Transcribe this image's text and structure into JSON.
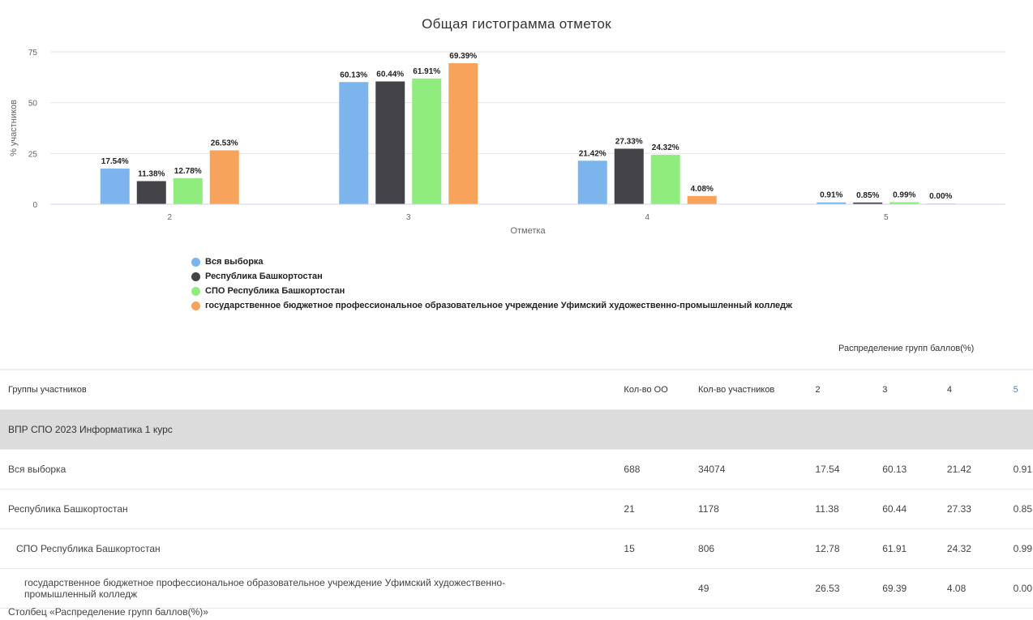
{
  "chart_data": {
    "type": "bar",
    "title": "Общая гистограмма отметок",
    "xlabel": "Отметка",
    "ylabel": "% участников",
    "categories": [
      "2",
      "3",
      "4",
      "5"
    ],
    "y_ticks": [
      "0",
      "25",
      "50",
      "75"
    ],
    "ylim": [
      0,
      75
    ],
    "grid": true,
    "legend_position": "bottom-left",
    "series": [
      {
        "name": "Вся выборка",
        "color": "#7cb5ec",
        "values": [
          17.54,
          60.13,
          21.42,
          0.91
        ],
        "labels": [
          "17.54%",
          "60.13%",
          "21.42%",
          "0.91%"
        ]
      },
      {
        "name": "Республика Башкортостан",
        "color": "#434348",
        "values": [
          11.38,
          60.44,
          27.33,
          0.85
        ],
        "labels": [
          "11.38%",
          "60.44%",
          "27.33%",
          "0.85%"
        ]
      },
      {
        "name": "СПО Республика Башкортостан",
        "color": "#90ed7d",
        "values": [
          12.78,
          61.91,
          24.32,
          0.99
        ],
        "labels": [
          "12.78%",
          "61.91%",
          "24.32%",
          "0.99%"
        ]
      },
      {
        "name": "государственное бюджетное профессиональное образовательное учреждение Уфимский художественно-промышленный колледж",
        "color": "#f7a35c",
        "values": [
          26.53,
          69.39,
          4.08,
          0.0
        ],
        "labels": [
          "26.53%",
          "69.39%",
          "4.08%",
          "0.00%"
        ]
      }
    ]
  },
  "table": {
    "dist_header": "Распределение групп баллов(%)",
    "columns": [
      "Группы участников",
      "Кол-во ОО",
      "Кол-во участников",
      "2",
      "3",
      "4",
      "5"
    ],
    "group_title": "ВПР СПО 2023 Информатика 1 курс",
    "rows": [
      {
        "name": "Вся выборка",
        "oo": "688",
        "participants": "34074",
        "g2": "17.54",
        "g3": "60.13",
        "g4": "21.42",
        "g5": "0.91"
      },
      {
        "name": "Республика Башкортостан",
        "oo": "21",
        "participants": "1178",
        "g2": "11.38",
        "g3": "60.44",
        "g4": "27.33",
        "g5": "0.85"
      },
      {
        "name": "СПО Республика Башкортостан",
        "oo": "15",
        "participants": "806",
        "g2": "12.78",
        "g3": "61.91",
        "g4": "24.32",
        "g5": "0.99"
      },
      {
        "name": "государственное бюджетное профессиональное образовательное учреждение Уфимский художественно-промышленный колледж",
        "oo": "",
        "participants": "49",
        "g2": "26.53",
        "g3": "69.39",
        "g4": "4.08",
        "g5": "0.00"
      }
    ]
  },
  "footer_note": "Столбец «Распределение групп баллов(%)»"
}
